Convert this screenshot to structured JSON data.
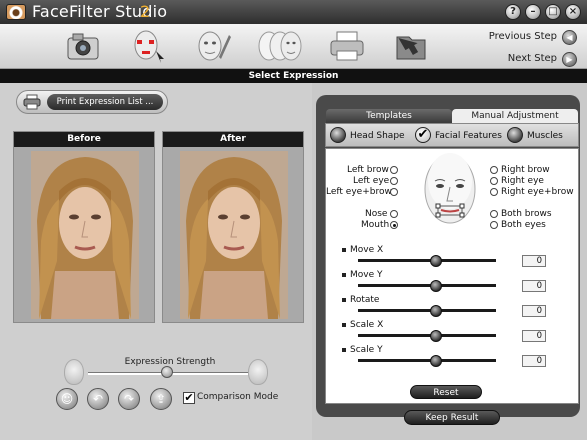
{
  "app": {
    "name": "FaceFilter Studio",
    "version": "2",
    "window_buttons": [
      "?",
      "–",
      "□",
      "×"
    ]
  },
  "toolbar": {
    "steps": [
      {
        "icon": "camera-icon"
      },
      {
        "icon": "face-markers-icon"
      },
      {
        "icon": "face-edit-icon"
      },
      {
        "icon": "faces-expressions-icon"
      },
      {
        "icon": "printer-icon"
      },
      {
        "icon": "folder-save-icon"
      }
    ],
    "previous_step": "Previous Step",
    "next_step": "Next Step"
  },
  "section_header": "Select Expression",
  "left": {
    "print_button": "Print Expression List ...",
    "before_label": "Before",
    "after_label": "After",
    "expression_strength_label": "Expression Strength",
    "expression_strength_value": 0.5,
    "comparison_mode_label": "Comparison Mode",
    "comparison_mode_checked": "✔"
  },
  "right": {
    "tabs": [
      "Templates",
      "Manual Adjustment"
    ],
    "active_tab": "Manual Adjustment",
    "sub_options": [
      "Head Shape",
      "Facial Features",
      "Muscles"
    ],
    "selected_sub_option": "Facial Features",
    "check_mark": "✔",
    "features_left": [
      "Left brow",
      "Left eye",
      "Left eye+brow",
      "Nose",
      "Mouth"
    ],
    "features_right": [
      "Right brow",
      "Right eye",
      "Right eye+brow",
      "Both brows",
      "Both eyes"
    ],
    "selected_feature": "Mouth",
    "sliders": [
      {
        "label": "Move X",
        "value": "0"
      },
      {
        "label": "Move Y",
        "value": "0"
      },
      {
        "label": "Rotate",
        "value": "0"
      },
      {
        "label": "Scale X",
        "value": "0"
      },
      {
        "label": "Scale Y",
        "value": "0"
      }
    ],
    "reset_label": "Reset",
    "keep_result_label": "Keep Result"
  },
  "colors": {
    "header_bg": "#111111",
    "panel_frame": "#4a4a4a",
    "accent_version": "#f0b030"
  }
}
